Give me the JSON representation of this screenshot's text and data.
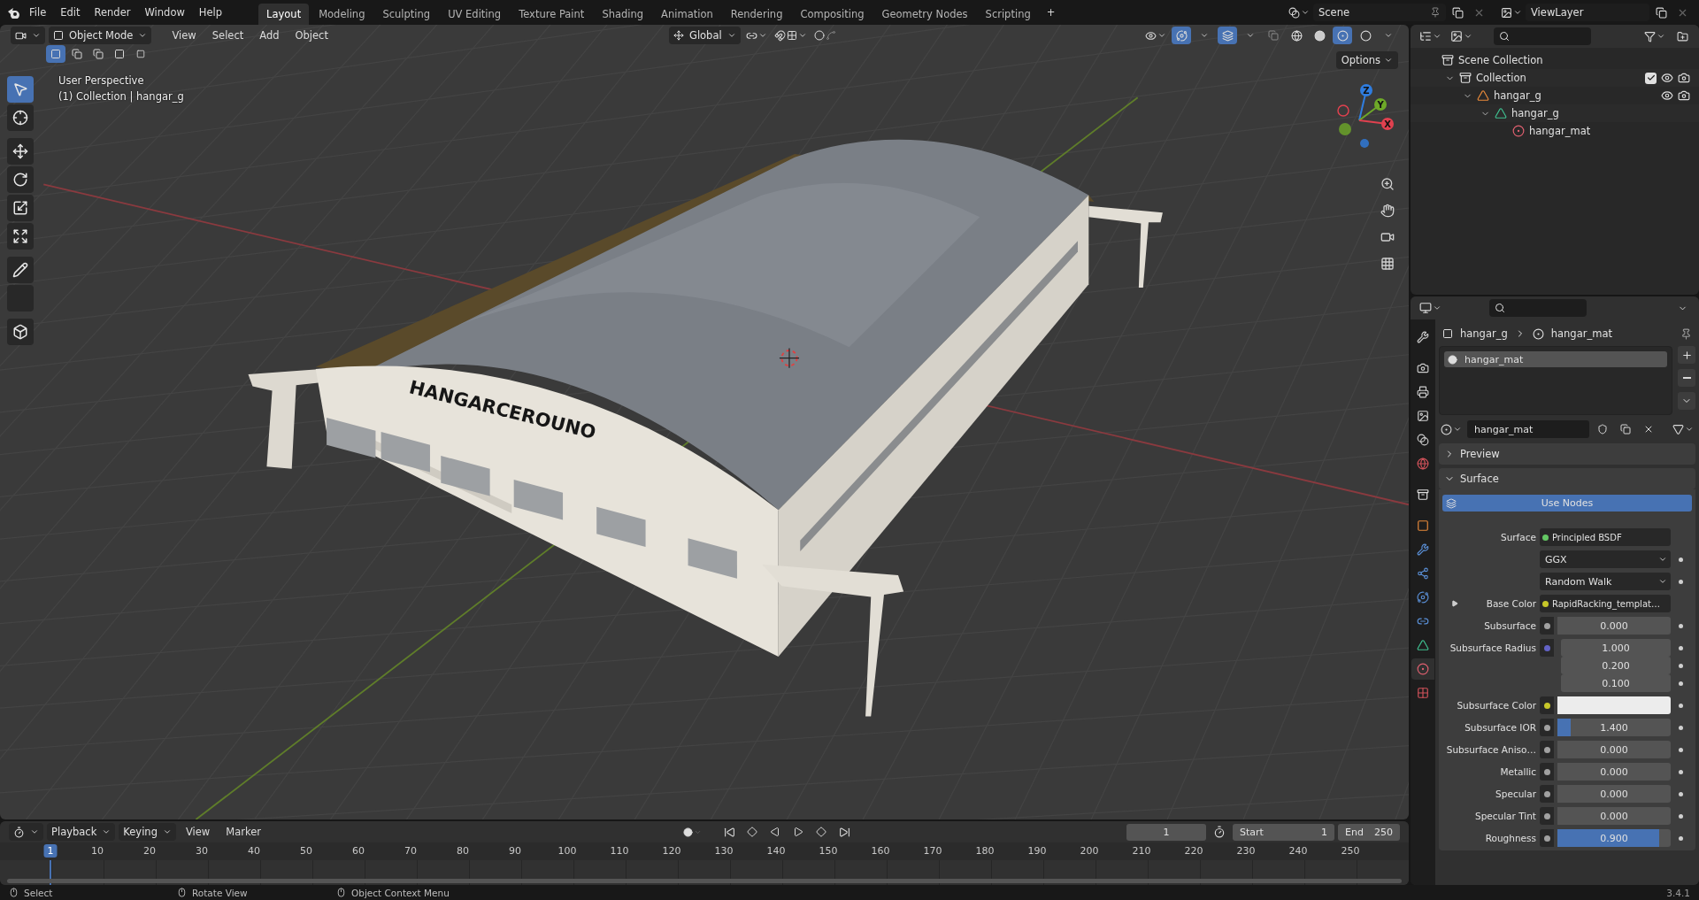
{
  "topbar": {
    "menus": [
      "File",
      "Edit",
      "Render",
      "Window",
      "Help"
    ],
    "workspaces": [
      {
        "label": "Layout",
        "selected": true
      },
      {
        "label": "Modeling",
        "selected": false
      },
      {
        "label": "Sculpting",
        "selected": false
      },
      {
        "label": "UV Editing",
        "selected": false
      },
      {
        "label": "Texture Paint",
        "selected": false
      },
      {
        "label": "Shading",
        "selected": false
      },
      {
        "label": "Animation",
        "selected": false
      },
      {
        "label": "Rendering",
        "selected": false
      },
      {
        "label": "Compositing",
        "selected": false
      },
      {
        "label": "Geometry Nodes",
        "selected": false
      },
      {
        "label": "Scripting",
        "selected": false
      }
    ],
    "add_tab": "+",
    "scene": "Scene",
    "view_layer": "ViewLayer"
  },
  "viewport": {
    "mode": "Object Mode",
    "menus": [
      "View",
      "Select",
      "Add",
      "Object"
    ],
    "orientation": "Global",
    "options": "Options",
    "overlay_text": [
      "User Perspective",
      "(1) Collection | hangar_g"
    ],
    "tools": [
      {
        "kind": "select",
        "selected": true
      },
      {
        "kind": "cursor",
        "selected": false
      },
      {
        "kind": "move",
        "selected": false
      },
      {
        "kind": "rotate",
        "selected": false
      },
      {
        "kind": "scale",
        "selected": false
      },
      {
        "kind": "transform",
        "selected": false
      },
      {
        "kind": "annotate",
        "selected": false
      },
      {
        "kind": "measure",
        "selected": false
      },
      {
        "kind": "add_cube",
        "selected": false
      }
    ],
    "gizmo": [
      {
        "label": "Z",
        "color": "#2f7de0"
      },
      {
        "label": "Y",
        "color": "#6ea928"
      },
      {
        "label": "X",
        "color": "#e0414f"
      }
    ],
    "model_lettering": "HANGARCEROUNO"
  },
  "outliner": {
    "tree": [
      {
        "label": "Scene Collection",
        "kind": "scene",
        "children": [
          {
            "label": "Collection",
            "kind": "collection",
            "expanded": true,
            "checked": true,
            "children": [
              {
                "label": "hangar_g",
                "kind": "object",
                "expanded": true,
                "children": [
                  {
                    "label": "hangar_g",
                    "kind": "mesh",
                    "expanded": true,
                    "children": [
                      {
                        "label": "hangar_mat",
                        "kind": "material"
                      }
                    ]
                  }
                ]
              }
            ]
          }
        ]
      }
    ]
  },
  "properties": {
    "tabs": [
      {
        "kind": "tool",
        "selected": false
      },
      {
        "kind": "render",
        "selected": false
      },
      {
        "kind": "output",
        "selected": false
      },
      {
        "kind": "view_layer",
        "selected": false
      },
      {
        "kind": "scene",
        "selected": false
      },
      {
        "kind": "world",
        "selected": false
      },
      {
        "kind": "collection",
        "selected": false
      },
      {
        "kind": "object",
        "selected": false
      },
      {
        "kind": "modifiers",
        "selected": false
      },
      {
        "kind": "particles",
        "selected": false
      },
      {
        "kind": "physics",
        "selected": false
      },
      {
        "kind": "constraints",
        "selected": false
      },
      {
        "kind": "data",
        "selected": false
      },
      {
        "kind": "material",
        "selected": true
      },
      {
        "kind": "texture",
        "selected": false
      }
    ],
    "breadcrumb": [
      "hangar_g",
      "hangar_mat"
    ],
    "slots": [
      {
        "label": "hangar_mat",
        "selected": true
      }
    ],
    "material_name": "hangar_mat",
    "panels": [
      {
        "label": "Preview",
        "expanded": false
      },
      {
        "label": "Surface",
        "expanded": true
      }
    ],
    "use_nodes": "Use Nodes",
    "rows": [
      {
        "kind": "link",
        "label": "Surface",
        "socket": {
          "color": "#63c763"
        },
        "value": "Principled BSDF"
      },
      {
        "kind": "dropdown",
        "value": "GGX"
      },
      {
        "kind": "dropdown",
        "value": "Random Walk"
      },
      {
        "kind": "texture",
        "label": "Base Color",
        "socket": {
          "color": "#c7c729"
        },
        "value": "RapidRacking_templat…"
      },
      {
        "kind": "slider",
        "label": "Subsurface",
        "socket": {
          "color": "#a1a1a1"
        },
        "value": "0.000",
        "level": 0
      },
      {
        "kind": "vector",
        "label": "Subsurface Radius",
        "socket": {
          "color": "#6363c7"
        },
        "values": [
          "1.000",
          "0.200",
          "0.100"
        ]
      },
      {
        "kind": "color",
        "label": "Subsurface Color",
        "socket": {
          "color": "#c7c729"
        },
        "color": "#ececec"
      },
      {
        "kind": "slider",
        "label": "Subsurface IOR",
        "socket": {
          "color": "#a1a1a1"
        },
        "value": "1.400",
        "level": 0.12
      },
      {
        "kind": "slider",
        "label": "Subsurface Aniso…",
        "socket": {
          "color": "#a1a1a1"
        },
        "value": "0.000",
        "level": 0
      },
      {
        "kind": "slider",
        "label": "Metallic",
        "socket": {
          "color": "#a1a1a1"
        },
        "value": "0.000",
        "level": 0
      },
      {
        "kind": "slider",
        "label": "Specular",
        "socket": {
          "color": "#a1a1a1"
        },
        "value": "0.000",
        "level": 0
      },
      {
        "kind": "slider",
        "label": "Specular Tint",
        "socket": {
          "color": "#a1a1a1"
        },
        "value": "0.000",
        "level": 0
      },
      {
        "kind": "slider",
        "label": "Roughness",
        "socket": {
          "color": "#a1a1a1"
        },
        "value": "0.900",
        "level": 0.9
      }
    ]
  },
  "timeline": {
    "menus": [
      "Playback",
      "Keying",
      "View",
      "Marker"
    ],
    "current_frame": "1",
    "start_label": "Start",
    "start": "1",
    "end_label": "End",
    "end": "250",
    "ruler": [
      {
        "label": "1",
        "selected": true
      },
      {
        "label": "10",
        "selected": false
      },
      {
        "label": "20",
        "selected": false
      },
      {
        "label": "30",
        "selected": false
      },
      {
        "label": "40",
        "selected": false
      },
      {
        "label": "50",
        "selected": false
      },
      {
        "label": "60",
        "selected": false
      },
      {
        "label": "70",
        "selected": false
      },
      {
        "label": "80",
        "selected": false
      },
      {
        "label": "90",
        "selected": false
      },
      {
        "label": "100",
        "selected": false
      },
      {
        "label": "110",
        "selected": false
      },
      {
        "label": "120",
        "selected": false
      },
      {
        "label": "130",
        "selected": false
      },
      {
        "label": "140",
        "selected": false
      },
      {
        "label": "150",
        "selected": false
      },
      {
        "label": "160",
        "selected": false
      },
      {
        "label": "170",
        "selected": false
      },
      {
        "label": "180",
        "selected": false
      },
      {
        "label": "190",
        "selected": false
      },
      {
        "label": "200",
        "selected": false
      },
      {
        "label": "210",
        "selected": false
      },
      {
        "label": "220",
        "selected": false
      },
      {
        "label": "230",
        "selected": false
      },
      {
        "label": "240",
        "selected": false
      },
      {
        "label": "250",
        "selected": false
      }
    ]
  },
  "status_bar": {
    "hints": [
      "Select",
      "Rotate View",
      "Object Context Menu"
    ],
    "version": "3.4.1"
  }
}
